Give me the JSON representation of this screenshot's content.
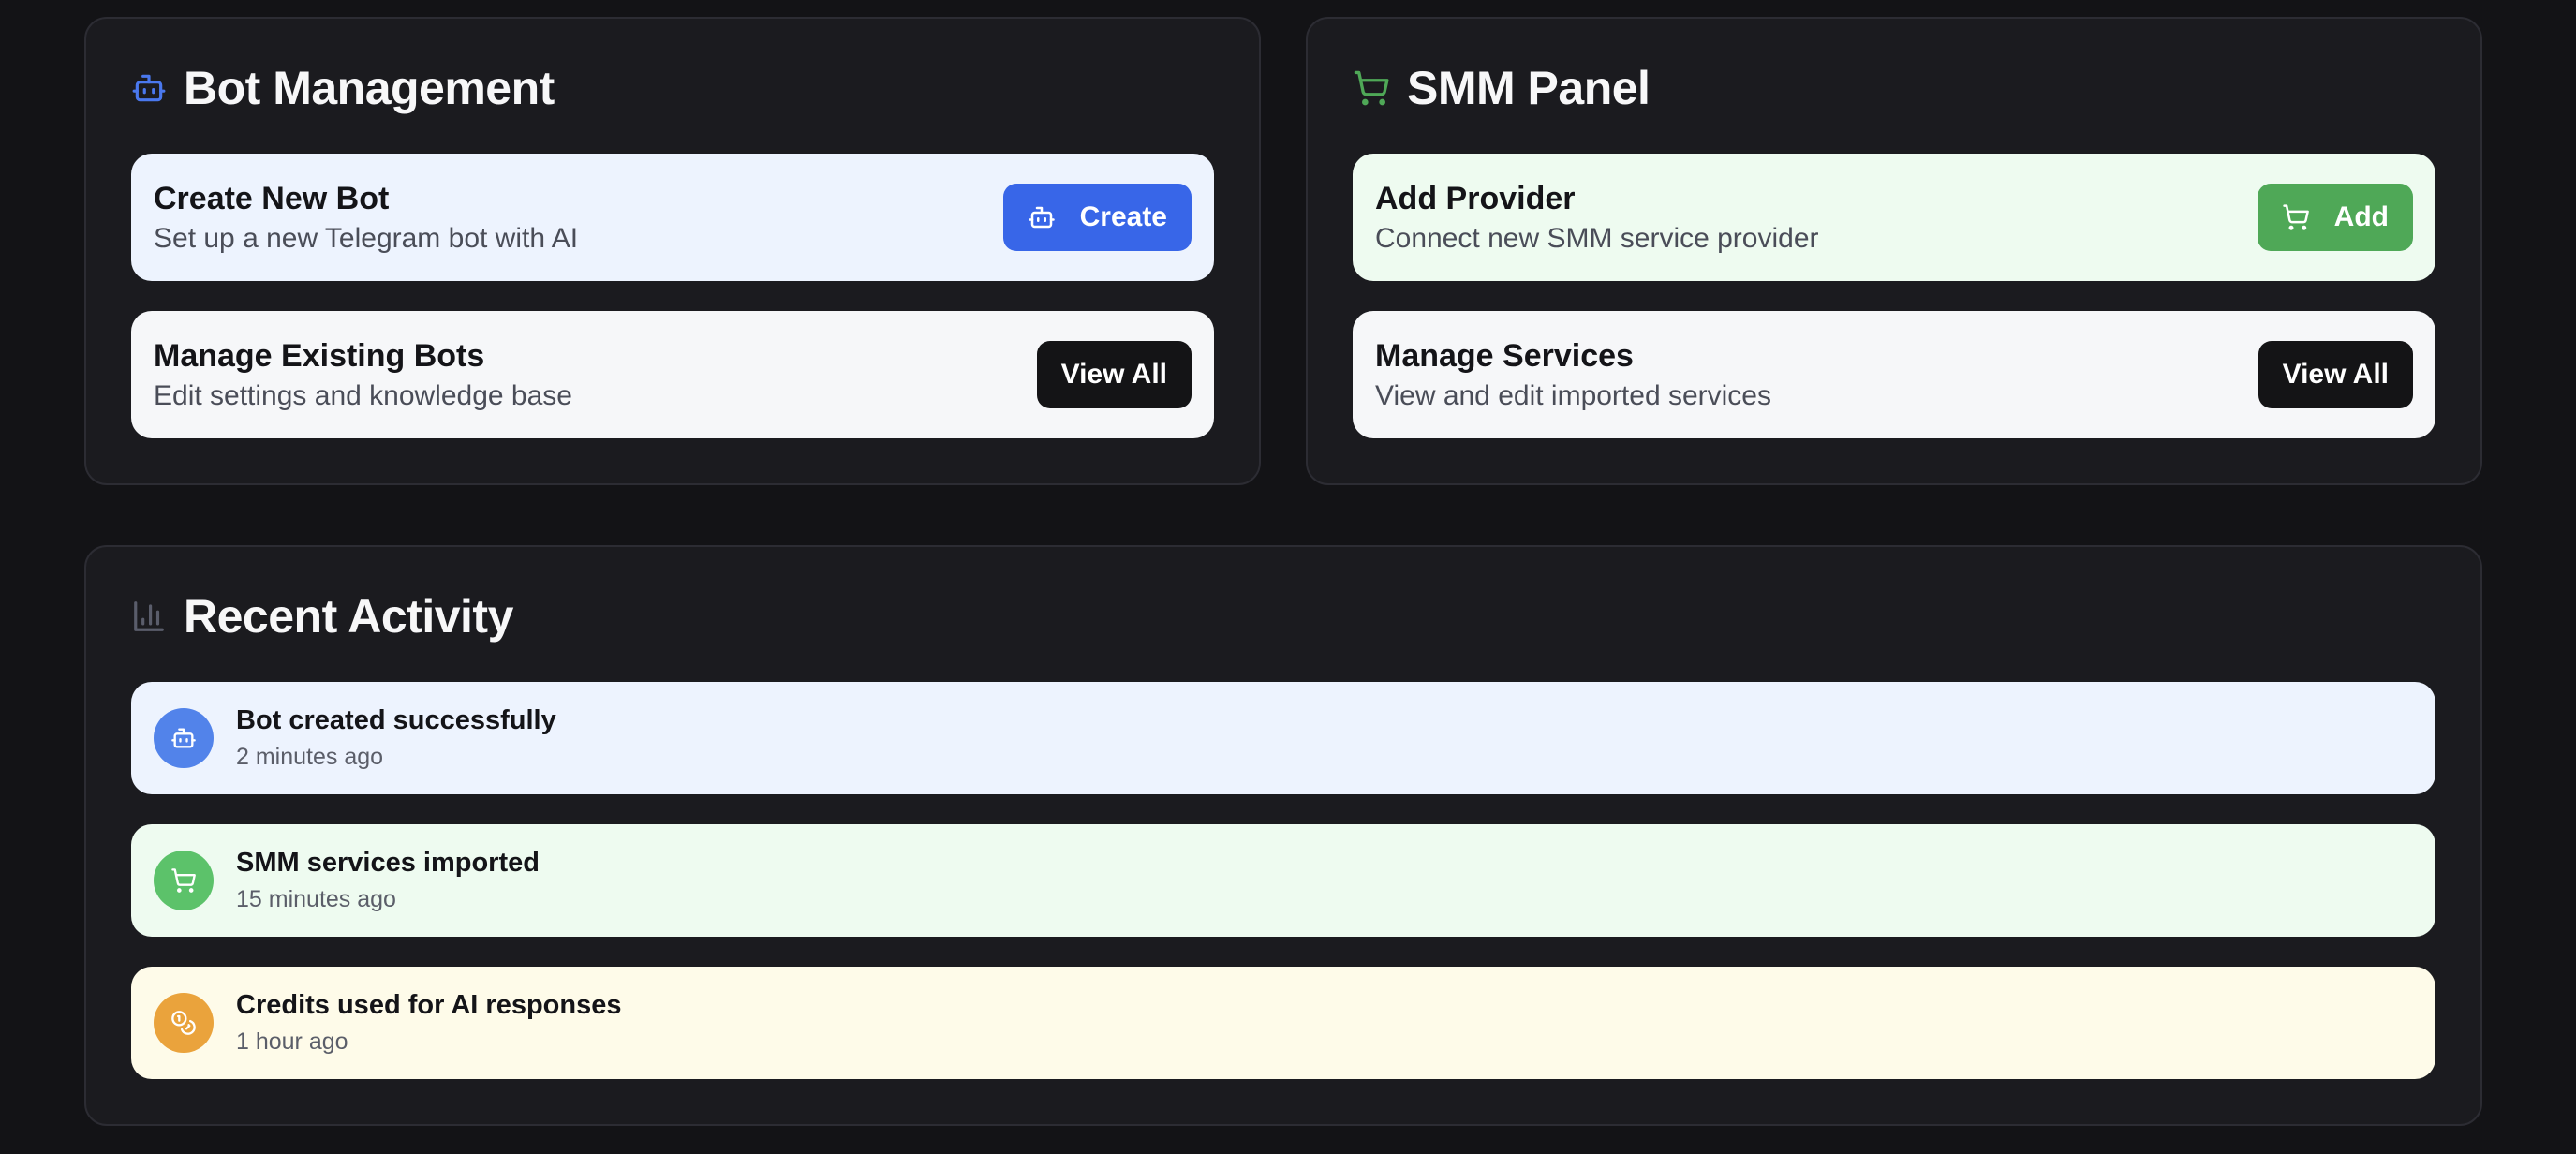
{
  "bot_management": {
    "title": "Bot Management",
    "icon": "robot-icon",
    "accent": "#4a78ee",
    "create_card": {
      "title": "Create New Bot",
      "subtitle": "Set up a new Telegram bot with AI",
      "button_label": "Create"
    },
    "manage_card": {
      "title": "Manage Existing Bots",
      "subtitle": "Edit settings and knowledge base",
      "button_label": "View All"
    }
  },
  "smm_panel": {
    "title": "SMM Panel",
    "icon": "shopping-cart-icon",
    "accent": "#4fa857",
    "add_card": {
      "title": "Add Provider",
      "subtitle": "Connect new SMM service provider",
      "button_label": "Add"
    },
    "manage_card": {
      "title": "Manage Services",
      "subtitle": "View and edit imported services",
      "button_label": "View All"
    }
  },
  "recent_activity": {
    "title": "Recent Activity",
    "icon": "bar-chart-icon",
    "items": [
      {
        "title": "Bot created successfully",
        "time": "2 minutes ago",
        "icon": "robot-icon",
        "color": "#5283ea"
      },
      {
        "title": "SMM services imported",
        "time": "15 minutes ago",
        "icon": "shopping-cart-icon",
        "color": "#5cc26a"
      },
      {
        "title": "Credits used for AI responses",
        "time": "1 hour ago",
        "icon": "coins-icon",
        "color": "#eaa33c"
      }
    ]
  }
}
